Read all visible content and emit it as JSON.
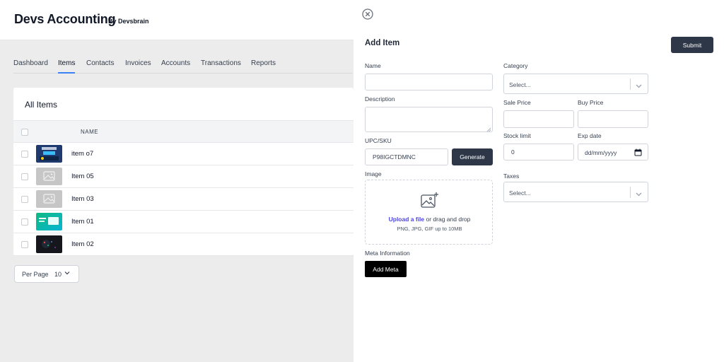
{
  "header": {
    "brand": "Devs Accounting",
    "byline": "By Devsbrain"
  },
  "nav": {
    "items": [
      "Dashboard",
      "Items",
      "Contacts",
      "Invoices",
      "Accounts",
      "Transactions",
      "Reports"
    ],
    "active": "Items"
  },
  "list": {
    "title": "All Items",
    "column_name": "NAME",
    "rows": [
      {
        "name": "item o7",
        "thumb": "blue-cover"
      },
      {
        "name": "Item 05",
        "thumb": "placeholder"
      },
      {
        "name": "Item 03",
        "thumb": "placeholder"
      },
      {
        "name": "Item 01",
        "thumb": "green-cover"
      },
      {
        "name": "Item 02",
        "thumb": "dark-cover"
      }
    ],
    "per_page_label": "Per Page",
    "per_page_value": "10"
  },
  "drawer": {
    "title": "Add Item",
    "submit_label": "Submit",
    "name_label": "Name",
    "name_value": "",
    "description_label": "Description",
    "upc_label": "UPC/SKU",
    "upc_value": "P98IGCTDMNC",
    "generate_label": "Generate",
    "image_label": "Image",
    "upload_link": "Upload a file",
    "upload_rest": " or drag and drop",
    "upload_hint": "PNG, JPG, GIF up to 10MB",
    "meta_label": "Meta Information",
    "add_meta_label": "Add Meta",
    "category_label": "Category",
    "category_placeholder": "Select...",
    "sale_price_label": "Sale Price",
    "buy_price_label": "Buy Price",
    "stock_limit_label": "Stock limit",
    "stock_limit_value": "0",
    "exp_date_label": "Exp date",
    "exp_date_value": "dd/mm/yyyy",
    "taxes_label": "Taxes",
    "taxes_placeholder": "Select..."
  },
  "colors": {
    "accent": "#3b82f6",
    "button_dark": "#2d3748",
    "link": "#4f46e5"
  },
  "icons": [
    "close-circle-icon",
    "chevron-down-icon",
    "image-add-icon",
    "calendar-icon",
    "checkbox-icon"
  ]
}
